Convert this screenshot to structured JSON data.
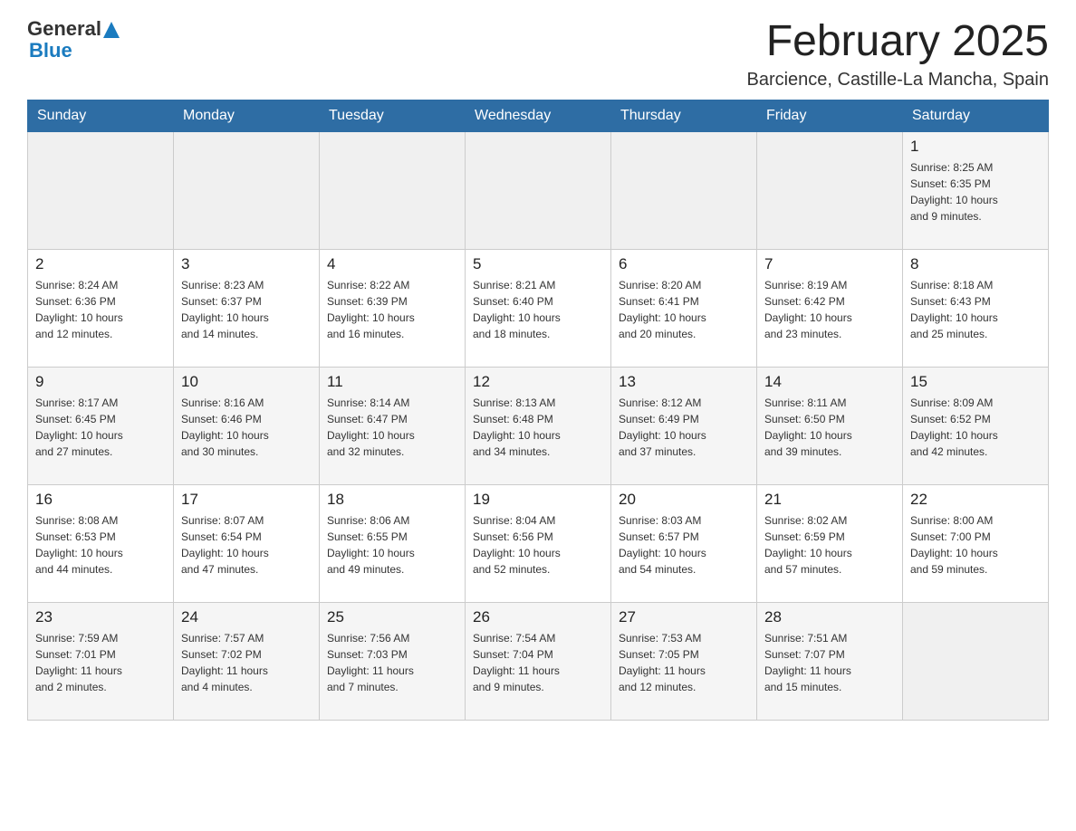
{
  "header": {
    "logo_general": "General",
    "logo_blue": "Blue",
    "month_title": "February 2025",
    "location": "Barcience, Castille-La Mancha, Spain"
  },
  "days_of_week": [
    "Sunday",
    "Monday",
    "Tuesday",
    "Wednesday",
    "Thursday",
    "Friday",
    "Saturday"
  ],
  "weeks": [
    {
      "days": [
        {
          "number": "",
          "info": ""
        },
        {
          "number": "",
          "info": ""
        },
        {
          "number": "",
          "info": ""
        },
        {
          "number": "",
          "info": ""
        },
        {
          "number": "",
          "info": ""
        },
        {
          "number": "",
          "info": ""
        },
        {
          "number": "1",
          "info": "Sunrise: 8:25 AM\nSunset: 6:35 PM\nDaylight: 10 hours\nand 9 minutes."
        }
      ]
    },
    {
      "days": [
        {
          "number": "2",
          "info": "Sunrise: 8:24 AM\nSunset: 6:36 PM\nDaylight: 10 hours\nand 12 minutes."
        },
        {
          "number": "3",
          "info": "Sunrise: 8:23 AM\nSunset: 6:37 PM\nDaylight: 10 hours\nand 14 minutes."
        },
        {
          "number": "4",
          "info": "Sunrise: 8:22 AM\nSunset: 6:39 PM\nDaylight: 10 hours\nand 16 minutes."
        },
        {
          "number": "5",
          "info": "Sunrise: 8:21 AM\nSunset: 6:40 PM\nDaylight: 10 hours\nand 18 minutes."
        },
        {
          "number": "6",
          "info": "Sunrise: 8:20 AM\nSunset: 6:41 PM\nDaylight: 10 hours\nand 20 minutes."
        },
        {
          "number": "7",
          "info": "Sunrise: 8:19 AM\nSunset: 6:42 PM\nDaylight: 10 hours\nand 23 minutes."
        },
        {
          "number": "8",
          "info": "Sunrise: 8:18 AM\nSunset: 6:43 PM\nDaylight: 10 hours\nand 25 minutes."
        }
      ]
    },
    {
      "days": [
        {
          "number": "9",
          "info": "Sunrise: 8:17 AM\nSunset: 6:45 PM\nDaylight: 10 hours\nand 27 minutes."
        },
        {
          "number": "10",
          "info": "Sunrise: 8:16 AM\nSunset: 6:46 PM\nDaylight: 10 hours\nand 30 minutes."
        },
        {
          "number": "11",
          "info": "Sunrise: 8:14 AM\nSunset: 6:47 PM\nDaylight: 10 hours\nand 32 minutes."
        },
        {
          "number": "12",
          "info": "Sunrise: 8:13 AM\nSunset: 6:48 PM\nDaylight: 10 hours\nand 34 minutes."
        },
        {
          "number": "13",
          "info": "Sunrise: 8:12 AM\nSunset: 6:49 PM\nDaylight: 10 hours\nand 37 minutes."
        },
        {
          "number": "14",
          "info": "Sunrise: 8:11 AM\nSunset: 6:50 PM\nDaylight: 10 hours\nand 39 minutes."
        },
        {
          "number": "15",
          "info": "Sunrise: 8:09 AM\nSunset: 6:52 PM\nDaylight: 10 hours\nand 42 minutes."
        }
      ]
    },
    {
      "days": [
        {
          "number": "16",
          "info": "Sunrise: 8:08 AM\nSunset: 6:53 PM\nDaylight: 10 hours\nand 44 minutes."
        },
        {
          "number": "17",
          "info": "Sunrise: 8:07 AM\nSunset: 6:54 PM\nDaylight: 10 hours\nand 47 minutes."
        },
        {
          "number": "18",
          "info": "Sunrise: 8:06 AM\nSunset: 6:55 PM\nDaylight: 10 hours\nand 49 minutes."
        },
        {
          "number": "19",
          "info": "Sunrise: 8:04 AM\nSunset: 6:56 PM\nDaylight: 10 hours\nand 52 minutes."
        },
        {
          "number": "20",
          "info": "Sunrise: 8:03 AM\nSunset: 6:57 PM\nDaylight: 10 hours\nand 54 minutes."
        },
        {
          "number": "21",
          "info": "Sunrise: 8:02 AM\nSunset: 6:59 PM\nDaylight: 10 hours\nand 57 minutes."
        },
        {
          "number": "22",
          "info": "Sunrise: 8:00 AM\nSunset: 7:00 PM\nDaylight: 10 hours\nand 59 minutes."
        }
      ]
    },
    {
      "days": [
        {
          "number": "23",
          "info": "Sunrise: 7:59 AM\nSunset: 7:01 PM\nDaylight: 11 hours\nand 2 minutes."
        },
        {
          "number": "24",
          "info": "Sunrise: 7:57 AM\nSunset: 7:02 PM\nDaylight: 11 hours\nand 4 minutes."
        },
        {
          "number": "25",
          "info": "Sunrise: 7:56 AM\nSunset: 7:03 PM\nDaylight: 11 hours\nand 7 minutes."
        },
        {
          "number": "26",
          "info": "Sunrise: 7:54 AM\nSunset: 7:04 PM\nDaylight: 11 hours\nand 9 minutes."
        },
        {
          "number": "27",
          "info": "Sunrise: 7:53 AM\nSunset: 7:05 PM\nDaylight: 11 hours\nand 12 minutes."
        },
        {
          "number": "28",
          "info": "Sunrise: 7:51 AM\nSunset: 7:07 PM\nDaylight: 11 hours\nand 15 minutes."
        },
        {
          "number": "",
          "info": ""
        }
      ]
    }
  ],
  "colors": {
    "header_bg": "#2e6da4",
    "header_text": "#ffffff",
    "border": "#cccccc",
    "row_alt": "#f5f5f5"
  }
}
